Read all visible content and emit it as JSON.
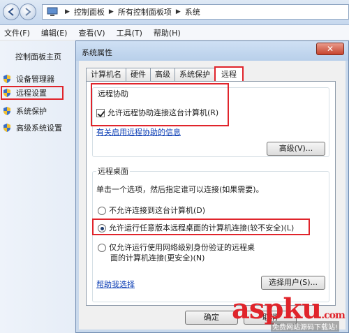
{
  "explorer": {
    "breadcrumb": [
      "控制面板",
      "所有控制面板项",
      "系统"
    ],
    "menu": [
      "文件(F)",
      "编辑(E)",
      "查看(V)",
      "工具(T)",
      "帮助(H)"
    ],
    "left_pane": {
      "home": "控制面板主页",
      "items": [
        "设备管理器",
        "远程设置",
        "系统保护",
        "高级系统设置"
      ]
    }
  },
  "dialog": {
    "title": "系统属性",
    "close_label": "✕",
    "tabs": [
      "计算机名",
      "硬件",
      "高级",
      "系统保护",
      "远程"
    ],
    "active_tab": "远程",
    "remote_assistance": {
      "group_title": "远程协助",
      "allow_checkbox": "允许远程协助连接这台计算机(R)",
      "allow_checked": true,
      "info_link": "有关启用远程协助的信息",
      "advanced_button": "高级(V)..."
    },
    "remote_desktop": {
      "group_title": "远程桌面",
      "instruction": "单击一个选项，然后指定谁可以连接(如果需要)。",
      "options": [
        "不允许连接到这台计算机(D)",
        "允许运行任意版本远程桌面的计算机连接(较不安全)(L)",
        "仅允许运行使用网络级别身份验证的远程桌面的计算机连接(更安全)(N)"
      ],
      "selected_option": 1,
      "help_link": "帮助我选择",
      "select_users_button": "选择用户(S)..."
    },
    "footer": {
      "ok_button": "确定",
      "cancel_button": "取消"
    }
  },
  "watermark": {
    "brand": "aspku",
    "brand_suffix": ".com",
    "tagline": "免费网站源码下载站!"
  },
  "colors": {
    "highlight_red": "#e0242b",
    "link_blue": "#0a3cb4"
  }
}
